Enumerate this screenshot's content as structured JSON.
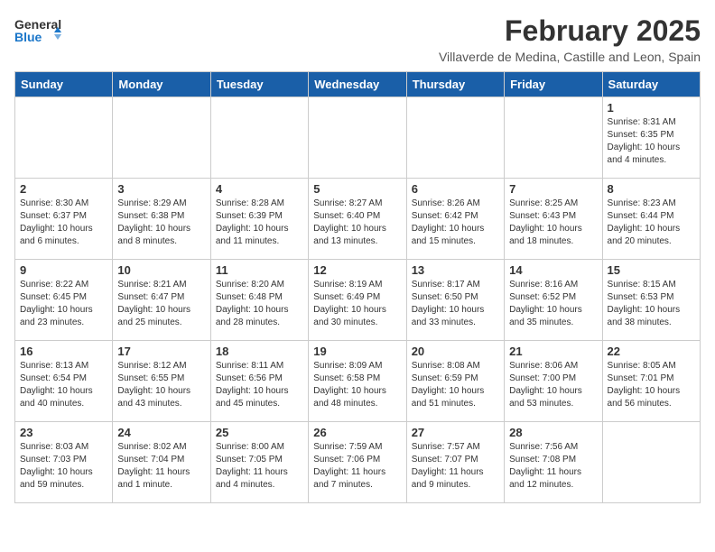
{
  "header": {
    "logo_general": "General",
    "logo_blue": "Blue",
    "month_year": "February 2025",
    "location": "Villaverde de Medina, Castille and Leon, Spain"
  },
  "weekdays": [
    "Sunday",
    "Monday",
    "Tuesday",
    "Wednesday",
    "Thursday",
    "Friday",
    "Saturday"
  ],
  "weeks": [
    [
      {
        "day": "",
        "info": ""
      },
      {
        "day": "",
        "info": ""
      },
      {
        "day": "",
        "info": ""
      },
      {
        "day": "",
        "info": ""
      },
      {
        "day": "",
        "info": ""
      },
      {
        "day": "",
        "info": ""
      },
      {
        "day": "1",
        "info": "Sunrise: 8:31 AM\nSunset: 6:35 PM\nDaylight: 10 hours\nand 4 minutes."
      }
    ],
    [
      {
        "day": "2",
        "info": "Sunrise: 8:30 AM\nSunset: 6:37 PM\nDaylight: 10 hours\nand 6 minutes."
      },
      {
        "day": "3",
        "info": "Sunrise: 8:29 AM\nSunset: 6:38 PM\nDaylight: 10 hours\nand 8 minutes."
      },
      {
        "day": "4",
        "info": "Sunrise: 8:28 AM\nSunset: 6:39 PM\nDaylight: 10 hours\nand 11 minutes."
      },
      {
        "day": "5",
        "info": "Sunrise: 8:27 AM\nSunset: 6:40 PM\nDaylight: 10 hours\nand 13 minutes."
      },
      {
        "day": "6",
        "info": "Sunrise: 8:26 AM\nSunset: 6:42 PM\nDaylight: 10 hours\nand 15 minutes."
      },
      {
        "day": "7",
        "info": "Sunrise: 8:25 AM\nSunset: 6:43 PM\nDaylight: 10 hours\nand 18 minutes."
      },
      {
        "day": "8",
        "info": "Sunrise: 8:23 AM\nSunset: 6:44 PM\nDaylight: 10 hours\nand 20 minutes."
      }
    ],
    [
      {
        "day": "9",
        "info": "Sunrise: 8:22 AM\nSunset: 6:45 PM\nDaylight: 10 hours\nand 23 minutes."
      },
      {
        "day": "10",
        "info": "Sunrise: 8:21 AM\nSunset: 6:47 PM\nDaylight: 10 hours\nand 25 minutes."
      },
      {
        "day": "11",
        "info": "Sunrise: 8:20 AM\nSunset: 6:48 PM\nDaylight: 10 hours\nand 28 minutes."
      },
      {
        "day": "12",
        "info": "Sunrise: 8:19 AM\nSunset: 6:49 PM\nDaylight: 10 hours\nand 30 minutes."
      },
      {
        "day": "13",
        "info": "Sunrise: 8:17 AM\nSunset: 6:50 PM\nDaylight: 10 hours\nand 33 minutes."
      },
      {
        "day": "14",
        "info": "Sunrise: 8:16 AM\nSunset: 6:52 PM\nDaylight: 10 hours\nand 35 minutes."
      },
      {
        "day": "15",
        "info": "Sunrise: 8:15 AM\nSunset: 6:53 PM\nDaylight: 10 hours\nand 38 minutes."
      }
    ],
    [
      {
        "day": "16",
        "info": "Sunrise: 8:13 AM\nSunset: 6:54 PM\nDaylight: 10 hours\nand 40 minutes."
      },
      {
        "day": "17",
        "info": "Sunrise: 8:12 AM\nSunset: 6:55 PM\nDaylight: 10 hours\nand 43 minutes."
      },
      {
        "day": "18",
        "info": "Sunrise: 8:11 AM\nSunset: 6:56 PM\nDaylight: 10 hours\nand 45 minutes."
      },
      {
        "day": "19",
        "info": "Sunrise: 8:09 AM\nSunset: 6:58 PM\nDaylight: 10 hours\nand 48 minutes."
      },
      {
        "day": "20",
        "info": "Sunrise: 8:08 AM\nSunset: 6:59 PM\nDaylight: 10 hours\nand 51 minutes."
      },
      {
        "day": "21",
        "info": "Sunrise: 8:06 AM\nSunset: 7:00 PM\nDaylight: 10 hours\nand 53 minutes."
      },
      {
        "day": "22",
        "info": "Sunrise: 8:05 AM\nSunset: 7:01 PM\nDaylight: 10 hours\nand 56 minutes."
      }
    ],
    [
      {
        "day": "23",
        "info": "Sunrise: 8:03 AM\nSunset: 7:03 PM\nDaylight: 10 hours\nand 59 minutes."
      },
      {
        "day": "24",
        "info": "Sunrise: 8:02 AM\nSunset: 7:04 PM\nDaylight: 11 hours\nand 1 minute."
      },
      {
        "day": "25",
        "info": "Sunrise: 8:00 AM\nSunset: 7:05 PM\nDaylight: 11 hours\nand 4 minutes."
      },
      {
        "day": "26",
        "info": "Sunrise: 7:59 AM\nSunset: 7:06 PM\nDaylight: 11 hours\nand 7 minutes."
      },
      {
        "day": "27",
        "info": "Sunrise: 7:57 AM\nSunset: 7:07 PM\nDaylight: 11 hours\nand 9 minutes."
      },
      {
        "day": "28",
        "info": "Sunrise: 7:56 AM\nSunset: 7:08 PM\nDaylight: 11 hours\nand 12 minutes."
      },
      {
        "day": "",
        "info": ""
      }
    ]
  ]
}
